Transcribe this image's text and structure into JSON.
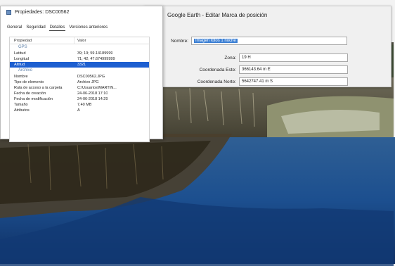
{
  "properties_window": {
    "title": "Propiedades: DSC00562",
    "tabs": [
      {
        "label": "General"
      },
      {
        "label": "Seguridad"
      },
      {
        "label": "Detalles",
        "active": true
      },
      {
        "label": "Versiones anteriores"
      }
    ],
    "columns": {
      "property": "Propiedad",
      "value": "Valor"
    },
    "gps_section": "GPS",
    "gps_rows": [
      {
        "key": "Latitud",
        "value": "39; 19; 59.14189999"
      },
      {
        "key": "Longitud",
        "value": "71; 42; 47.674999999"
      },
      {
        "key": "Altitud",
        "value": "3321"
      }
    ],
    "file_section": "Archivo",
    "file_rows": [
      {
        "key": "Nombre",
        "value": "DSC00562.JPG"
      },
      {
        "key": "Tipo de elemento",
        "value": "Archivo JPG"
      },
      {
        "key": "Ruta de acceso a la carpeta",
        "value": "C:\\Usuarios\\MARTIN..."
      },
      {
        "key": "Fecha de creación",
        "value": "24-06-2018 17:10"
      },
      {
        "key": "Fecha de modificación",
        "value": "24-06-2018 14:29"
      },
      {
        "key": "Tamaño",
        "value": "7,40 MB"
      },
      {
        "key": "Atributos",
        "value": "A"
      }
    ]
  },
  "google_earth_window": {
    "title": "Google Earth - Editar Marca de posición",
    "name_label": "Nombre:",
    "name_value": "Imagen fotos 1 noche",
    "zone_label": "Zona:",
    "zone_value": "19 H",
    "east_label": "Coordenada Este:",
    "east_value": "366143.64 m E",
    "north_label": "Coordenada Norte:",
    "north_value": "5642747.41 m S"
  },
  "colors": {
    "selection": "#1d5fd0",
    "section_header": "#5c7fa8"
  }
}
